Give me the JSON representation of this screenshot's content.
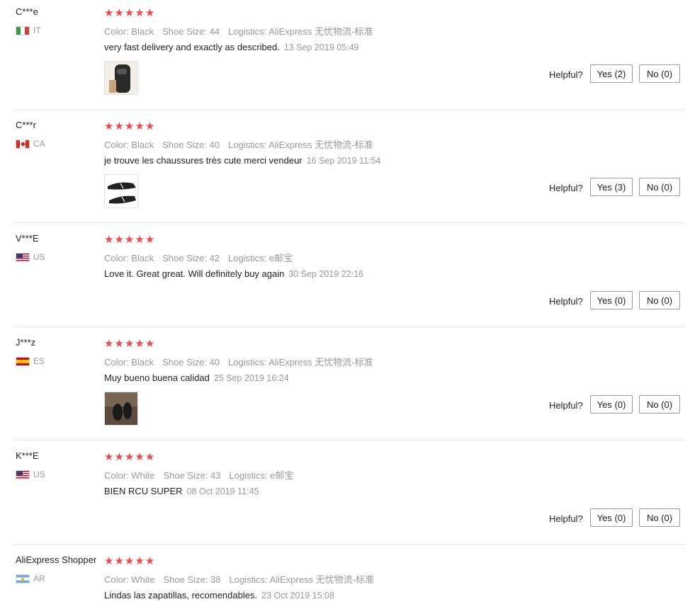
{
  "helpful_label": "Helpful?",
  "star_color": "#f04848",
  "reviews": [
    {
      "user": "C***e",
      "country": "IT",
      "rating": 5,
      "color": "Color: Black",
      "size": "Shoe Size: 44",
      "logistics": "Logistics: AliExpress 无忧物流-标准",
      "text": "very fast delivery and exactly as described.",
      "date": "13 Sep 2019 05:49",
      "has_photo": true,
      "yes": "Yes (2)",
      "no": "No (0)"
    },
    {
      "user": "C***r",
      "country": "CA",
      "rating": 5,
      "color": "Color: Black",
      "size": "Shoe Size: 40",
      "logistics": "Logistics: AliExpress 无忧物流-标准",
      "text": "je trouve les chaussures très cute merci vendeur",
      "date": "16 Sep 2019 11:54",
      "has_photo": true,
      "yes": "Yes (3)",
      "no": "No (0)"
    },
    {
      "user": "V***E",
      "country": "US",
      "rating": 5,
      "color": "Color: Black",
      "size": "Shoe Size: 42",
      "logistics": "Logistics: e邮宝",
      "text": "Love it. Great great. Will definitely buy again",
      "date": "30 Sep 2019 22:16",
      "has_photo": false,
      "yes": "Yes (0)",
      "no": "No (0)"
    },
    {
      "user": "J***z",
      "country": "ES",
      "rating": 5,
      "color": "Color: Black",
      "size": "Shoe Size: 40",
      "logistics": "Logistics: AliExpress 无忧物流-标准",
      "text": "Muy bueno buena calidad",
      "date": "25 Sep 2019 16:24",
      "has_photo": true,
      "yes": "Yes (0)",
      "no": "No (0)"
    },
    {
      "user": "K***E",
      "country": "US",
      "rating": 5,
      "color": "Color: White",
      "size": "Shoe Size: 43",
      "logistics": "Logistics: e邮宝",
      "text": "BIEN RCU SUPER",
      "date": "08 Oct 2019 11:45",
      "has_photo": false,
      "yes": "Yes (0)",
      "no": "No (0)"
    },
    {
      "user": "AliExpress Shopper",
      "country": "AR",
      "rating": 5,
      "color": "Color: White",
      "size": "Shoe Size: 38",
      "logistics": "Logistics: AliExpress 无忧物流-标准",
      "text": "Lindas las zapatillas, recomendables.",
      "date": "23 Oct 2019 15:08",
      "has_photo": false,
      "yes": "",
      "no": ""
    }
  ]
}
